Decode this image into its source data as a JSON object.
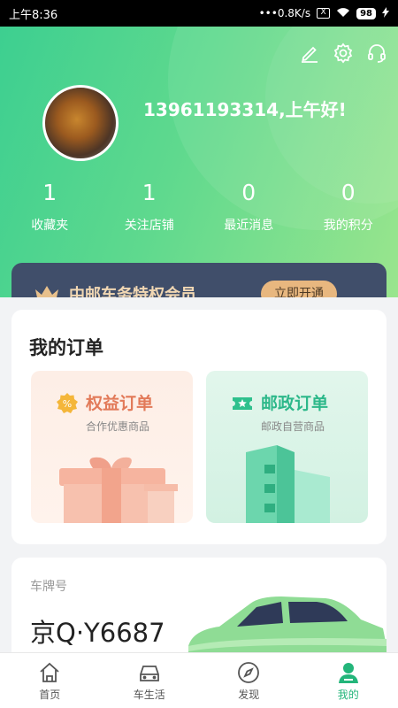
{
  "status_bar": {
    "time": "上午8:36",
    "network": "•••0.8K/s",
    "x_icon": "X",
    "battery": "98"
  },
  "header": {
    "greeting": "13961193314,上午好!",
    "icons": [
      "edit-icon",
      "settings-icon",
      "headset-icon"
    ],
    "stats": [
      {
        "value": "1",
        "label": "收藏夹"
      },
      {
        "value": "1",
        "label": "关注店铺"
      },
      {
        "value": "0",
        "label": "最近消息"
      },
      {
        "value": "0",
        "label": "我的积分"
      }
    ]
  },
  "vip": {
    "title": "中邮车务特权会员",
    "button": "立即开通"
  },
  "orders": {
    "title": "我的订单",
    "left": {
      "title": "权益订单",
      "subtitle": "合作优惠商品"
    },
    "right": {
      "title": "邮政订单",
      "subtitle": "邮政自营商品"
    }
  },
  "plate": {
    "label": "车牌号",
    "number": "京Q·Y6687"
  },
  "nav": [
    {
      "label": "首页",
      "icon": "home-icon"
    },
    {
      "label": "车生活",
      "icon": "car-icon"
    },
    {
      "label": "发现",
      "icon": "compass-icon"
    },
    {
      "label": "我的",
      "icon": "person-icon",
      "active": true
    }
  ],
  "colors": {
    "brand_green": "#23b57a",
    "vip_bg": "#404e6a",
    "vip_gold": "#e8b77f"
  }
}
